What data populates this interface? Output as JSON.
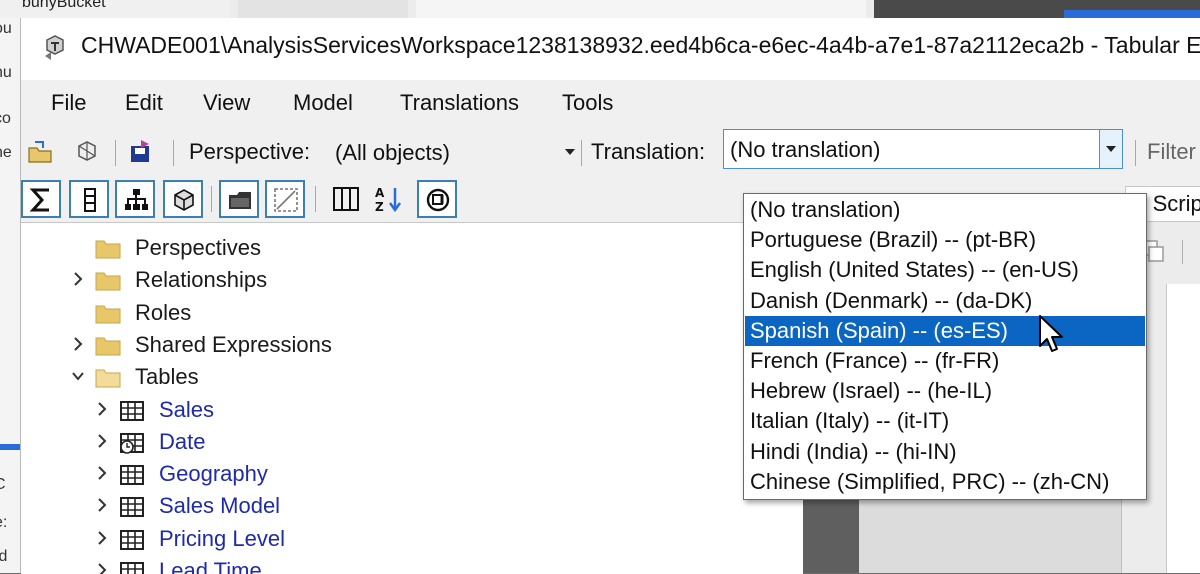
{
  "background": {
    "top_fragment": "bunyBucket",
    "left_fragments": [
      "ou",
      "nu",
      "co",
      "ne",
      "C",
      "e:",
      "Id"
    ]
  },
  "window": {
    "title": "CHWADE001\\AnalysisServicesWorkspace1238138932.eed4b6ca-e6ec-4a4b-a7e1-87a2112eca2b - Tabular Ec"
  },
  "menu": [
    "File",
    "Edit",
    "View",
    "Model",
    "Translations",
    "Tools"
  ],
  "toolbar": {
    "perspective_label": "Perspective:",
    "perspective_value": "(All objects)",
    "translation_label": "Translation:",
    "translation_value": "(No translation)",
    "filter_label": "Filter"
  },
  "right_panel": {
    "tab_fragment": "ed Scrip"
  },
  "tree": [
    {
      "label": "Perspectives",
      "expander": "none",
      "icon": "folder-icon",
      "level": 0
    },
    {
      "label": "Relationships",
      "expander": "collapsed",
      "icon": "folder-icon",
      "level": 0
    },
    {
      "label": "Roles",
      "expander": "none",
      "icon": "folder-icon",
      "level": 0
    },
    {
      "label": "Shared Expressions",
      "expander": "collapsed",
      "icon": "folder-icon",
      "level": 0
    },
    {
      "label": "Tables",
      "expander": "expanded",
      "icon": "folder-open-icon",
      "level": 0
    },
    {
      "label": "Sales",
      "expander": "collapsed",
      "icon": "table-icon",
      "level": 1
    },
    {
      "label": "Date",
      "expander": "collapsed",
      "icon": "calendar-table-icon",
      "level": 1
    },
    {
      "label": "Geography",
      "expander": "collapsed",
      "icon": "table-icon",
      "level": 1
    },
    {
      "label": "Sales Model",
      "expander": "collapsed",
      "icon": "table-icon",
      "level": 1
    },
    {
      "label": "Pricing Level",
      "expander": "collapsed",
      "icon": "table-icon",
      "level": 1
    },
    {
      "label": "Lead Time",
      "expander": "collapsed",
      "icon": "table-icon",
      "level": 1
    }
  ],
  "translation_options": [
    "(No translation)",
    "Portuguese (Brazil) -- (pt-BR)",
    "English (United States) -- (en-US)",
    "Danish (Denmark) -- (da-DK)",
    "Spanish (Spain) -- (es-ES)",
    "French (France) -- (fr-FR)",
    "Hebrew (Israel) -- (he-IL)",
    "Italian (Italy) -- (it-IT)",
    "Hindi (India) -- (hi-IN)",
    "Chinese (Simplified, PRC) -- (zh-CN)"
  ],
  "highlighted_option_index": 4,
  "colors": {
    "selection": "#0a66c2",
    "tree_link_text": "#1f2aa8",
    "folder": "#e8c76a",
    "focus_border": "#3c7fb1"
  }
}
